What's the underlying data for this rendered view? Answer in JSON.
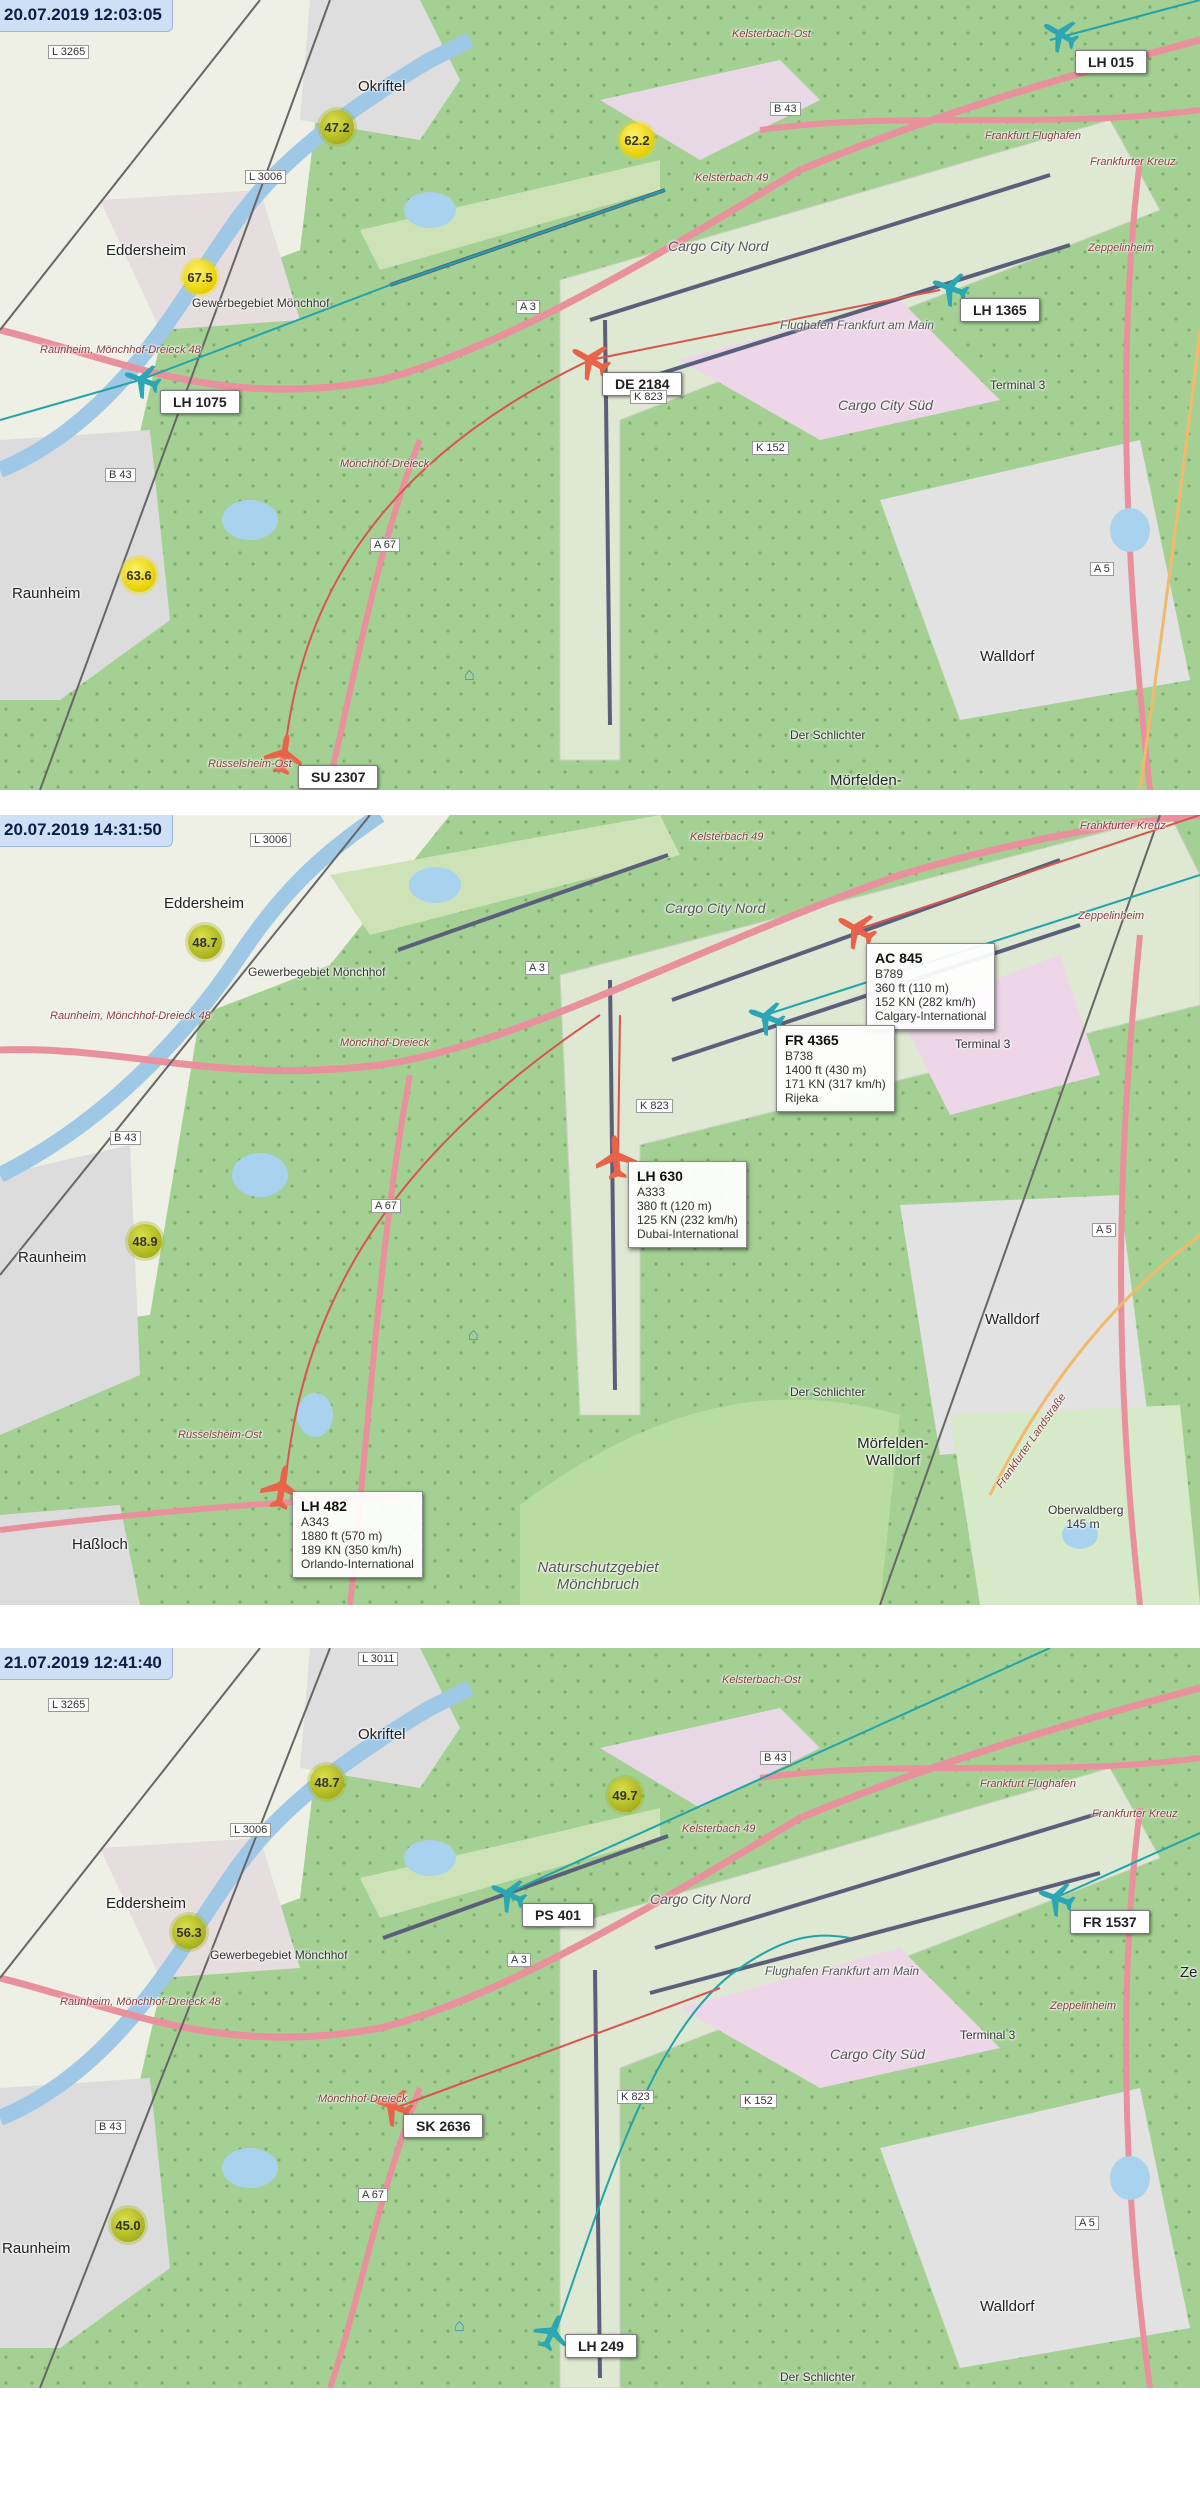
{
  "colors": {
    "forest": "#9ccb8b",
    "town": "#dcdcdc",
    "airport": "#e0e9d5",
    "motorway": "#e8919c",
    "track_red": "#d9534f",
    "track_teal": "#1fa4a9",
    "plane_red": "#e8634a",
    "plane_teal": "#2aa6b4",
    "noise_yellow": "#f2dc00",
    "noise_olive": "#a8b31b"
  },
  "panels": [
    {
      "timestamp": "20.07.2019 12:03:05",
      "flights": [
        {
          "callsign": "LH 015",
          "plane": "teal"
        },
        {
          "callsign": "LH 1365",
          "plane": "teal"
        },
        {
          "callsign": "DE 2184",
          "plane": "red"
        },
        {
          "callsign": "LH 1075",
          "plane": "teal"
        },
        {
          "callsign": "SU 2307",
          "plane": "red"
        }
      ],
      "noise": [
        {
          "value": "47.2",
          "color": "olive"
        },
        {
          "value": "62.2",
          "color": "yellow"
        },
        {
          "value": "67.5",
          "color": "yellow"
        },
        {
          "value": "63.6",
          "color": "yellow"
        }
      ],
      "places": {
        "okriftel": "Okriftel",
        "eddersheim": "Eddersheim",
        "raunheim": "Raunheim",
        "walldorf": "Walldorf",
        "moerfelden": "Mörfelden-",
        "cargo_nord": "Cargo City Nord",
        "cargo_sued": "Cargo City Süd",
        "flughafen": "Flughafen Frankfurt am Main",
        "terminal3": "Terminal 3",
        "schlichter": "Der Schlichter",
        "gewerbe": "Gewerbegebiet Mönchhof",
        "kelsterbach_ost": "Kelsterbach-Ost",
        "frankfurt_flughafen": "Frankfurt Flughafen",
        "frankfurter_kreuz": "Frankfurter Kreuz",
        "zeppelinheim": "Zeppelinheim",
        "raunheim_moenchhof": "Raunheim, Mönchhof-Dreieck 48",
        "moenchhof_dreieck": "Mönchhof-Dreieck",
        "ruesselsheim_ost": "Rüsselsheim-Ost",
        "kelsterbach": "Kelsterbach 49"
      },
      "roads": [
        "L 3265",
        "L 3006",
        "B 43",
        "A 3",
        "A 67",
        "A 5",
        "K 823",
        "K 152",
        "B 43"
      ]
    },
    {
      "timestamp": "20.07.2019 14:31:50",
      "flights": [
        {
          "callsign": "AC 845",
          "type": "B789",
          "altitude": "360 ft (110 m)",
          "speed": "152 KN (282 km/h)",
          "origin": "Calgary-International",
          "plane": "red"
        },
        {
          "callsign": "FR 4365",
          "type": "B738",
          "altitude": "1400 ft (430 m)",
          "speed": "171 KN (317 km/h)",
          "origin": "Rijeka",
          "plane": "teal"
        },
        {
          "callsign": "LH 630",
          "type": "A333",
          "altitude": "380 ft (120 m)",
          "speed": "125 KN (232 km/h)",
          "origin": "Dubai-International",
          "plane": "red"
        },
        {
          "callsign": "LH 482",
          "type": "A343",
          "altitude": "1880 ft (570 m)",
          "speed": "189 KN (350 km/h)",
          "origin": "Orlando-International",
          "plane": "red"
        }
      ],
      "noise": [
        {
          "value": "48.7",
          "color": "olive"
        },
        {
          "value": "48.9",
          "color": "olive"
        }
      ],
      "places": {
        "eddersheim": "Eddersheim",
        "raunheim": "Raunheim",
        "hassloch": "Haßloch",
        "walldorf": "Walldorf",
        "moerfelden": "Mörfelden-Walldorf",
        "oberwaldberg": "Oberwaldberg 145 m",
        "naturschutz": "Naturschutzgebiet Mönchbruch",
        "cargo_nord": "Cargo City Nord",
        "terminal3": "Terminal 3",
        "schlichter": "Der Schlichter",
        "gewerbe": "Gewerbegebiet Mönchhof",
        "frankfurter_kreuz": "Frankfurter Kreuz",
        "zeppelinheim": "Zeppelinheim",
        "moenchhof_dreieck": "Mönchhof-Dreieck",
        "ruesselsheim_ost": "Rüsselsheim-Ost",
        "kelsterbach": "Kelsterbach 49",
        "raunheim_moenchhof": "Raunheim, Mönchhof-Dreieck 48",
        "landstrasse": "Frankfurter Landstraße"
      },
      "roads": [
        "L 3006",
        "B 43",
        "A 3",
        "A 67",
        "A 5",
        "K 823"
      ]
    },
    {
      "timestamp": "21.07.2019 12:41:40",
      "flights": [
        {
          "callsign": "PS 401",
          "plane": "teal"
        },
        {
          "callsign": "FR 1537",
          "plane": "teal"
        },
        {
          "callsign": "SK 2636",
          "plane": "red"
        },
        {
          "callsign": "LH 249",
          "plane": "teal"
        }
      ],
      "noise": [
        {
          "value": "48.7",
          "color": "olive"
        },
        {
          "value": "49.7",
          "color": "olive"
        },
        {
          "value": "56.3",
          "color": "olive"
        },
        {
          "value": "45.0",
          "color": "olive"
        }
      ],
      "places": {
        "okriftel": "Okriftel",
        "eddersheim": "Eddersheim",
        "raunheim": "Raunheim",
        "walldorf": "Walldorf",
        "cargo_nord": "Cargo City Nord",
        "cargo_sued": "Cargo City Süd",
        "flughafen": "Flughafen Frankfurt am Main",
        "terminal3": "Terminal 3",
        "schlichter": "Der Schlichter",
        "gewerbe": "Gewerbegebiet Mönchhof",
        "kelsterbach_ost": "Kelsterbach-Ost",
        "frankfurt_flughafen": "Frankfurt Flughafen",
        "frankfurter_kreuz": "Frankfurter Kreuz",
        "zeppelinheim": "Zeppelinheim",
        "raunheim_moenchhof": "Raunheim, Mönchhof-Dreieck 48",
        "moenchhof_dreieck": "Mönchhof-Dreieck",
        "kelsterbach": "Kelsterbach 49",
        "ze": "Ze"
      },
      "roads": [
        "L 3011",
        "L 3265",
        "L 3006",
        "B 43",
        "B 43",
        "A 3",
        "A 67",
        "A 5",
        "K 823",
        "K 152"
      ]
    }
  ]
}
